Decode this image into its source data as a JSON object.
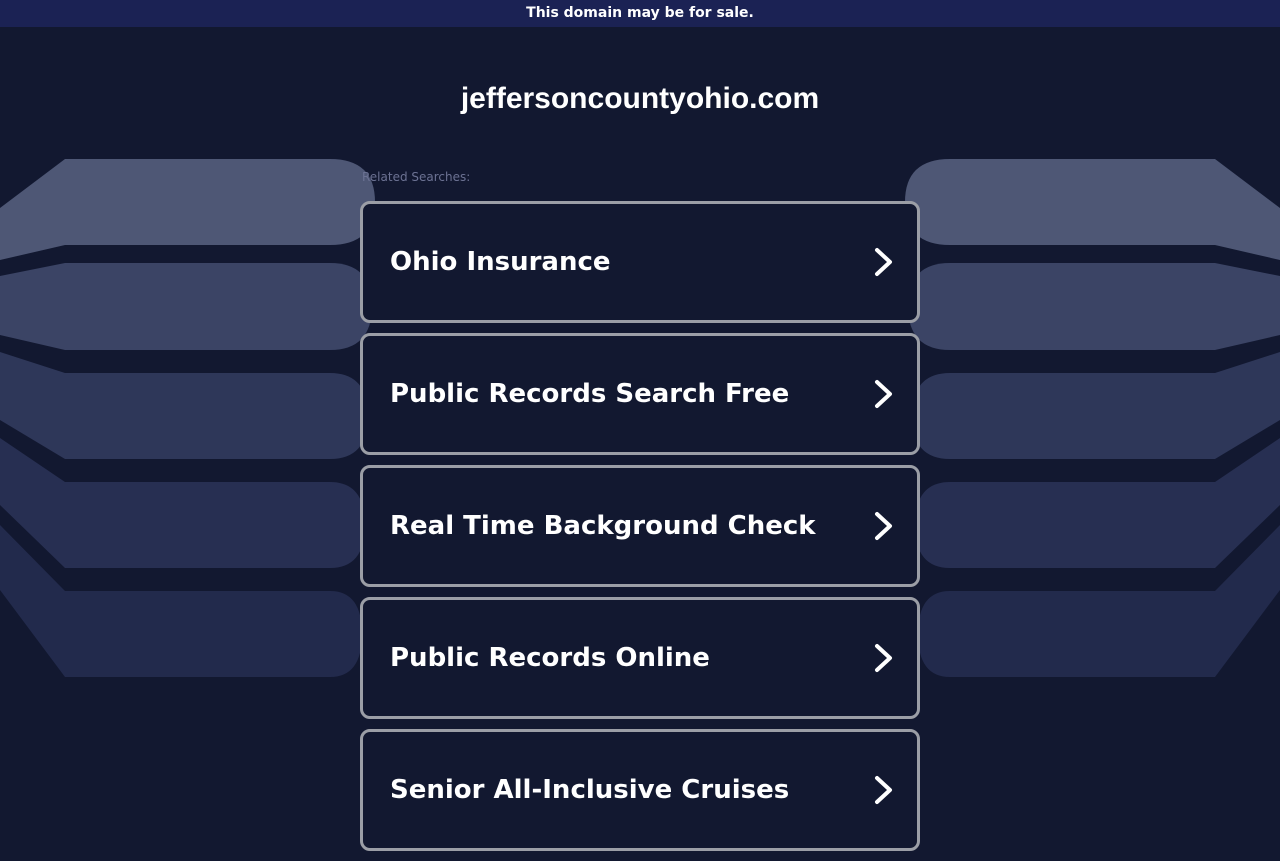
{
  "banner": {
    "text": "This domain may be for sale."
  },
  "site": {
    "domain": "jeffersoncountyohio.com"
  },
  "related": {
    "label": "Related Searches:",
    "items": [
      {
        "label": "Ohio Insurance",
        "icon": "chevron-right-icon"
      },
      {
        "label": "Public Records Search Free",
        "icon": "chevron-right-icon"
      },
      {
        "label": "Real Time Background Check",
        "icon": "chevron-right-icon"
      },
      {
        "label": "Public Records Online",
        "icon": "chevron-right-icon"
      },
      {
        "label": "Senior All-Inclusive Cruises",
        "icon": "chevron-right-icon"
      }
    ]
  },
  "colors": {
    "background": "#121830",
    "banner": "#1b2254",
    "item_border": "#9b9ea6",
    "deco_light": "#4e5775",
    "deco_dark": "#222c4c"
  }
}
